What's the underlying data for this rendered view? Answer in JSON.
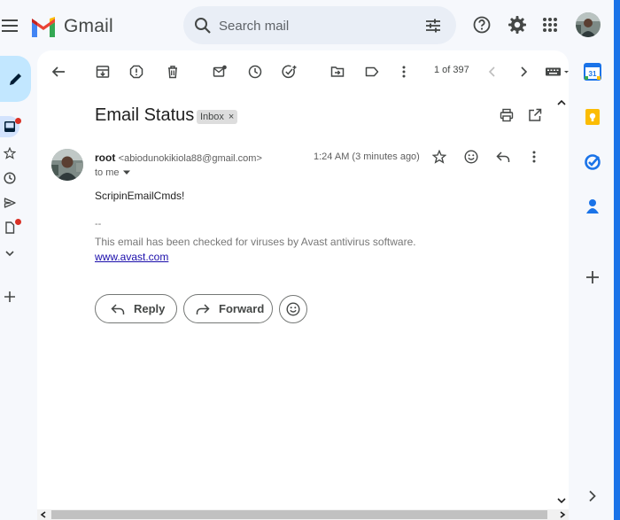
{
  "app": {
    "name": "Gmail",
    "logo_icon": "gmail-logo-icon"
  },
  "search": {
    "placeholder": "Search mail"
  },
  "header_icons": [
    "help-icon",
    "settings-gear-icon",
    "apps-grid-icon",
    "account-avatar"
  ],
  "toolbar": {
    "icons": [
      "back-arrow-icon",
      "archive-icon",
      "report-spam-icon",
      "delete-icon",
      "mark-unread-icon",
      "snooze-icon",
      "add-to-tasks-icon",
      "move-to-icon",
      "label-icon",
      "more-icon"
    ],
    "page_count": "1 of 397"
  },
  "message": {
    "subject": "Email Status",
    "label_badge": "Inbox",
    "label_remove": "×",
    "sender_name": "root",
    "sender_email": "<abiodunokikiola88@gmail.com>",
    "recipient": "to me",
    "timestamp": "1:24 AM (3 minutes ago)",
    "body": "ScripinEmailCmds!",
    "signature_dash": "--",
    "signature_text": "This email has been checked for viruses by Avast antivirus software.",
    "signature_link": "www.avast.com"
  },
  "actions": {
    "reply_label": "Reply",
    "forward_label": "Forward"
  },
  "side_apps": [
    {
      "name": "Calendar",
      "icon": "calendar-icon",
      "text": "31"
    },
    {
      "name": "Keep",
      "icon": "keep-icon"
    },
    {
      "name": "Tasks",
      "icon": "tasks-icon"
    },
    {
      "name": "Contacts",
      "icon": "contacts-icon"
    }
  ],
  "colors": {
    "accent": "#1a73e8",
    "compose_bg": "#c2e7ff",
    "search_bg": "#e9eef6",
    "badge_red": "#d93025",
    "link": "#1a0dab"
  }
}
